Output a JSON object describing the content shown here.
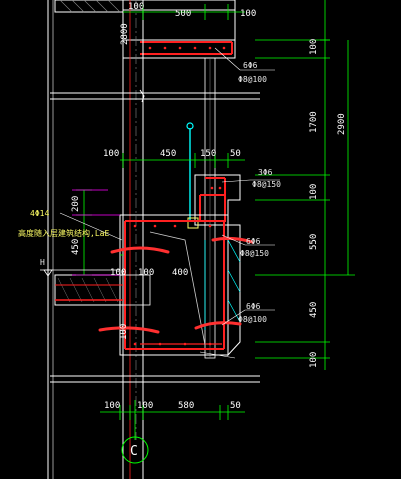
{
  "colors": {
    "background": "#000000",
    "concrete": "#ffffff",
    "dimension": "#00ff00",
    "rebar": "#ff2020",
    "marker": "#ff3030",
    "leader": "#ff00ff",
    "hatch": "#00ffff",
    "text": "#ffffff",
    "note": "#ffff66"
  },
  "dims_top": {
    "d1": "100",
    "d2": "500",
    "d3": "100"
  },
  "dims_right": {
    "r100a": "100",
    "r1700": "1700",
    "r2900": "2900",
    "r100b": "100",
    "r550": "550",
    "r450": "450",
    "r100c": "100"
  },
  "dims_mid": {
    "m100": "100",
    "m450": "450",
    "m150": "150",
    "m50": "50"
  },
  "dims_left": {
    "l200": "200",
    "l450": "450",
    "l2800": "2800"
  },
  "dims_inner": {
    "i100a": "100",
    "i100b": "100",
    "i400": "400",
    "i100c": "100"
  },
  "dims_bottom": {
    "b100a": "100",
    "b100b": "100",
    "b580": "580",
    "b50": "50"
  },
  "rebar_labels": {
    "top_main": "6Φ6",
    "top_dist": "Φ8@100",
    "mid_main": "3Φ6",
    "mid_dist": "Φ8@150",
    "side_main": "6Φ6",
    "side_dist": "Φ8@150",
    "bot_main": "6Φ6",
    "bot_dist": "Φ8@100"
  },
  "notes": {
    "left_bar": "4Φ14",
    "left_note": "高度随入层建筑结构,LaE",
    "level_mark": "H"
  },
  "axis": {
    "label": "C"
  }
}
